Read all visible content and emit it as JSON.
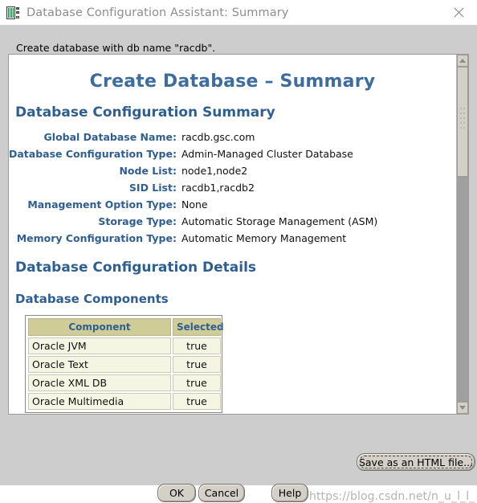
{
  "window": {
    "title": "Database Configuration Assistant: Summary",
    "icon": "database-icon",
    "close_icon": "close-icon"
  },
  "instruction": "Create database with db name \"racdb\".",
  "document": {
    "title": "Create Database – Summary",
    "summary_heading": "Database Configuration Summary",
    "summary_rows": [
      {
        "label": "Global Database Name:",
        "value": "racdb.gsc.com"
      },
      {
        "label": "Database Configuration Type:",
        "value": "Admin-Managed Cluster Database"
      },
      {
        "label": "Node List:",
        "value": "node1,node2"
      },
      {
        "label": "SID List:",
        "value": "racdb1,racdb2"
      },
      {
        "label": "Management Option Type:",
        "value": "None"
      },
      {
        "label": "Storage Type:",
        "value": "Automatic Storage Management (ASM)"
      },
      {
        "label": "Memory Configuration Type:",
        "value": "Automatic Memory Management"
      }
    ],
    "details_heading": "Database Configuration Details",
    "components_heading": "Database Components",
    "components_table": {
      "columns": [
        "Component",
        "Selected"
      ],
      "rows": [
        {
          "component": "Oracle JVM",
          "selected": "true"
        },
        {
          "component": "Oracle Text",
          "selected": "true"
        },
        {
          "component": "Oracle XML DB",
          "selected": "true"
        },
        {
          "component": "Oracle Multimedia",
          "selected": "true"
        }
      ]
    }
  },
  "scrollbar": {
    "up_icon": "scroll-up-arrow-icon",
    "down_icon": "scroll-down-arrow-icon"
  },
  "buttons": {
    "save_html": "Save as an HTML file...",
    "ok": "OK",
    "cancel": "Cancel",
    "help": "Help"
  },
  "watermark": "https://blog.csdn.net/n_u_l_l_",
  "colors": {
    "heading_blue": "#2f5f91",
    "title_blue": "#3d6c9e",
    "table_header_bg": "#cfcc98",
    "table_cell_bg": "#f5f5e3",
    "dialog_bg": "#cdcdcd"
  }
}
